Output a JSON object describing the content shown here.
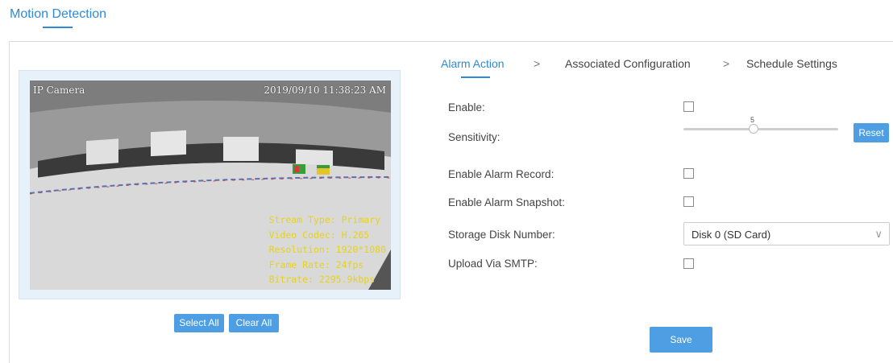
{
  "page": {
    "tab_label": "Motion Detection"
  },
  "video": {
    "camera_name": "IP Camera",
    "timestamp": "2019/09/10 11:38:23 AM",
    "stream_type": "Stream Type: Primary",
    "video_codec": "Video Codec: H.265",
    "resolution": "Resolution: 1920*1080",
    "frame_rate": "Frame Rate: 24fps",
    "bitrate": "Bitrate: 2295.9kbps",
    "osd_color": "#e8d21a"
  },
  "area_buttons": {
    "select_all": "Select All",
    "clear_all": "Clear All"
  },
  "steps": {
    "alarm_action": "Alarm Action",
    "sep1": ">",
    "associated_configuration": "Associated Configuration",
    "sep2": ">",
    "schedule_settings": "Schedule Settings"
  },
  "form": {
    "enable_label": "Enable:",
    "enable_checked": false,
    "sensitivity_label": "Sensitivity:",
    "sensitivity_value": "5",
    "reset_label": "Reset",
    "alarm_record_label": "Enable Alarm Record:",
    "alarm_record_checked": false,
    "alarm_snapshot_label": "Enable Alarm Snapshot:",
    "alarm_snapshot_checked": false,
    "storage_disk_label": "Storage Disk Number:",
    "storage_disk_value": "Disk 0 (SD Card)",
    "smtp_label": "Upload Via SMTP:",
    "smtp_checked": false,
    "save_label": "Save"
  },
  "colors": {
    "accent": "#2e8ad8",
    "button": "#4d9ee3"
  }
}
